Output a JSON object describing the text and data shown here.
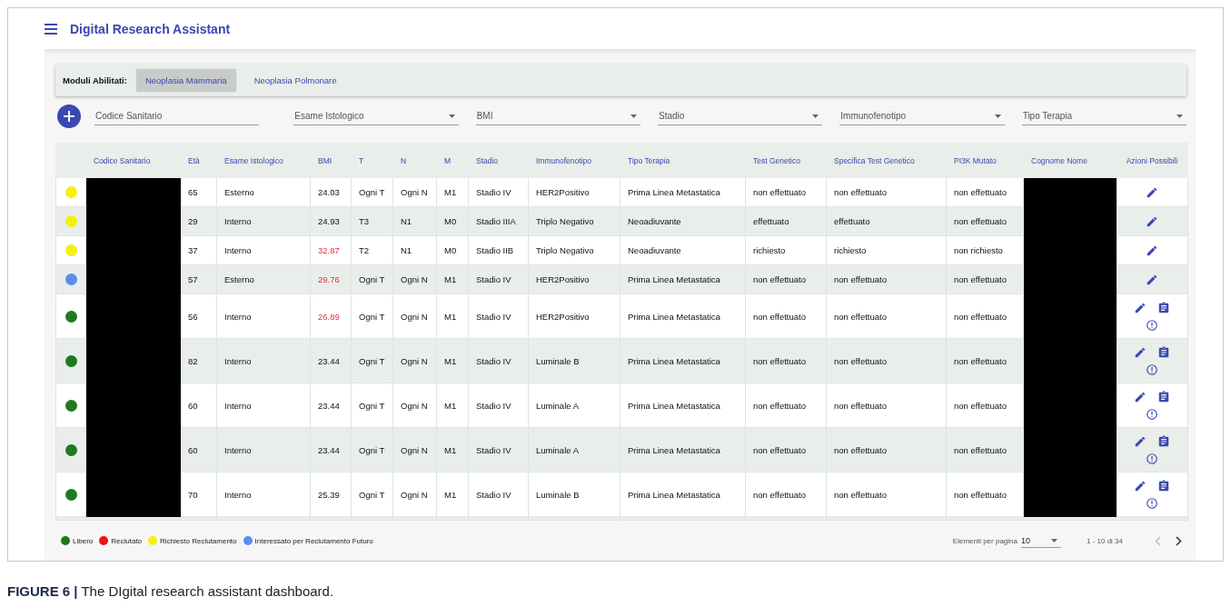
{
  "app": {
    "title": "Digital Research Assistant"
  },
  "modules": {
    "label": "Moduli Abilitati:",
    "tabs": [
      {
        "label": "Neoplasia Mammaria",
        "selected": true
      },
      {
        "label": "Neoplasia Polmonare",
        "selected": false
      }
    ]
  },
  "filters": [
    {
      "kind": "text",
      "placeholder": "Codice Sanitario"
    },
    {
      "kind": "select",
      "placeholder": "Esame Istologico"
    },
    {
      "kind": "select",
      "placeholder": "BMI"
    },
    {
      "kind": "select",
      "placeholder": "Stadio"
    },
    {
      "kind": "select",
      "placeholder": "Immunofenotipo"
    },
    {
      "kind": "select",
      "placeholder": "Tipo Terapia"
    }
  ],
  "table": {
    "columns": [
      "",
      "Codice Sanitario",
      "Età",
      "Esame Istologico",
      "BMI",
      "T",
      "N",
      "M",
      "Stadio",
      "Immunofenotipo",
      "Tipo Terapia",
      "Test Genetico",
      "Specifica Test Genetico",
      "PI3K Mutato",
      "Cognome Nome",
      "Azioni Possibili"
    ],
    "rows": [
      {
        "color": "#f2f20c",
        "redacted": true,
        "eta": "65",
        "esame": "Esterno",
        "bmi": "24.03",
        "bmi_alert": false,
        "t": "Ogni T",
        "n": "Ogni N",
        "m": "M1",
        "stadio": "Stadio IV",
        "immuno": "HER2Positivo",
        "terapia": "Prima Linea Metastatica",
        "test": "non effettuato",
        "specifica": "non effettuato",
        "pi3k": "non effettuato",
        "actions": [
          {
            "kind": "edit"
          }
        ]
      },
      {
        "color": "#f2f20c",
        "redacted": true,
        "eta": "29",
        "esame": "Interno",
        "bmi": "24.93",
        "bmi_alert": false,
        "t": "T3",
        "n": "N1",
        "m": "M0",
        "stadio": "Stadio IIIA",
        "immuno": "Triplo Negativo",
        "terapia": "Neoadiuvante",
        "test": "effettuato",
        "specifica": "effettuato",
        "pi3k": "non effettuato",
        "actions": [
          {
            "kind": "edit"
          }
        ]
      },
      {
        "color": "#f2f20c",
        "redacted": true,
        "eta": "37",
        "esame": "Interno",
        "bmi": "32.87",
        "bmi_alert": true,
        "t": "T2",
        "n": "N1",
        "m": "M0",
        "stadio": "Stadio IIB",
        "immuno": "Triplo Negativo",
        "terapia": "Neoadiuvante",
        "test": "richiesto",
        "specifica": "richiesto",
        "pi3k": "non richiesto",
        "actions": [
          {
            "kind": "edit"
          }
        ]
      },
      {
        "color": "#5b8def",
        "redacted": true,
        "eta": "57",
        "esame": "Esterno",
        "bmi": "29.76",
        "bmi_alert": true,
        "t": "Ogni T",
        "n": "Ogni N",
        "m": "M1",
        "stadio": "Stadio IV",
        "immuno": "HER2Positivo",
        "terapia": "Prima Linea Metastatica",
        "test": "non effettuato",
        "specifica": "non effettuato",
        "pi3k": "non effettuato",
        "actions": [
          {
            "kind": "edit"
          }
        ]
      },
      {
        "color": "#1e7a1e",
        "redacted": true,
        "eta": "56",
        "esame": "Interno",
        "bmi": "26.89",
        "bmi_alert": true,
        "t": "Ogni T",
        "n": "Ogni N",
        "m": "M1",
        "stadio": "Stadio IV",
        "immuno": "HER2Positivo",
        "terapia": "Prima Linea Metastatica",
        "test": "non effettuato",
        "specifica": "non effettuato",
        "pi3k": "non effettuato",
        "actions": [
          {
            "kind": "edit"
          },
          {
            "kind": "report"
          },
          {
            "kind": "alert"
          }
        ]
      },
      {
        "color": "#1e7a1e",
        "redacted": true,
        "eta": "82",
        "esame": "Interno",
        "bmi": "23.44",
        "bmi_alert": false,
        "t": "Ogni T",
        "n": "Ogni N",
        "m": "M1",
        "stadio": "Stadio IV",
        "immuno": "Luminale B",
        "terapia": "Prima Linea Metastatica",
        "test": "non effettuato",
        "specifica": "non effettuato",
        "pi3k": "non effettuato",
        "actions": [
          {
            "kind": "edit"
          },
          {
            "kind": "report"
          },
          {
            "kind": "alert"
          }
        ]
      },
      {
        "color": "#1e7a1e",
        "redacted": true,
        "eta": "60",
        "esame": "Interno",
        "bmi": "23.44",
        "bmi_alert": false,
        "t": "Ogni T",
        "n": "Ogni N",
        "m": "M1",
        "stadio": "Stadio IV",
        "immuno": "Luminale A",
        "terapia": "Prima Linea Metastatica",
        "test": "non effettuato",
        "specifica": "non effettuato",
        "pi3k": "non effettuato",
        "actions": [
          {
            "kind": "edit"
          },
          {
            "kind": "report"
          },
          {
            "kind": "alert"
          }
        ]
      },
      {
        "color": "#1e7a1e",
        "redacted": true,
        "eta": "60",
        "esame": "Interno",
        "bmi": "23.44",
        "bmi_alert": false,
        "t": "Ogni T",
        "n": "Ogni N",
        "m": "M1",
        "stadio": "Stadio IV",
        "immuno": "Luminale A",
        "terapia": "Prima Linea Metastatica",
        "test": "non effettuato",
        "specifica": "non effettuato",
        "pi3k": "non effettuato",
        "actions": [
          {
            "kind": "edit"
          },
          {
            "kind": "report"
          },
          {
            "kind": "alert"
          }
        ]
      },
      {
        "color": "#1e7a1e",
        "redacted": true,
        "eta": "70",
        "esame": "Interno",
        "bmi": "25.39",
        "bmi_alert": false,
        "t": "Ogni T",
        "n": "Ogni N",
        "m": "M1",
        "stadio": "Stadio IV",
        "immuno": "Luminale B",
        "terapia": "Prima Linea Metastatica",
        "test": "non effettuato",
        "specifica": "non effettuato",
        "pi3k": "non effettuato",
        "actions": [
          {
            "kind": "edit"
          },
          {
            "kind": "report"
          },
          {
            "kind": "alert"
          }
        ]
      }
    ]
  },
  "legend": [
    {
      "label": "Libero",
      "color": "#1e7a1e"
    },
    {
      "label": "Reclutato",
      "color": "#e8141b"
    },
    {
      "label": "Richiesto Reclutamento",
      "color": "#f2f20c"
    },
    {
      "label": "Interessato per Reclutamento Futuro",
      "color": "#5b8def"
    }
  ],
  "pagination": {
    "label": "Elementi per pagina",
    "page_size": "10",
    "range": "1 - 10 di 34",
    "prev_disabled": true,
    "next_disabled": false
  },
  "caption": "**FIGURE 6 |** The DIgital research assistant dashboard."
}
